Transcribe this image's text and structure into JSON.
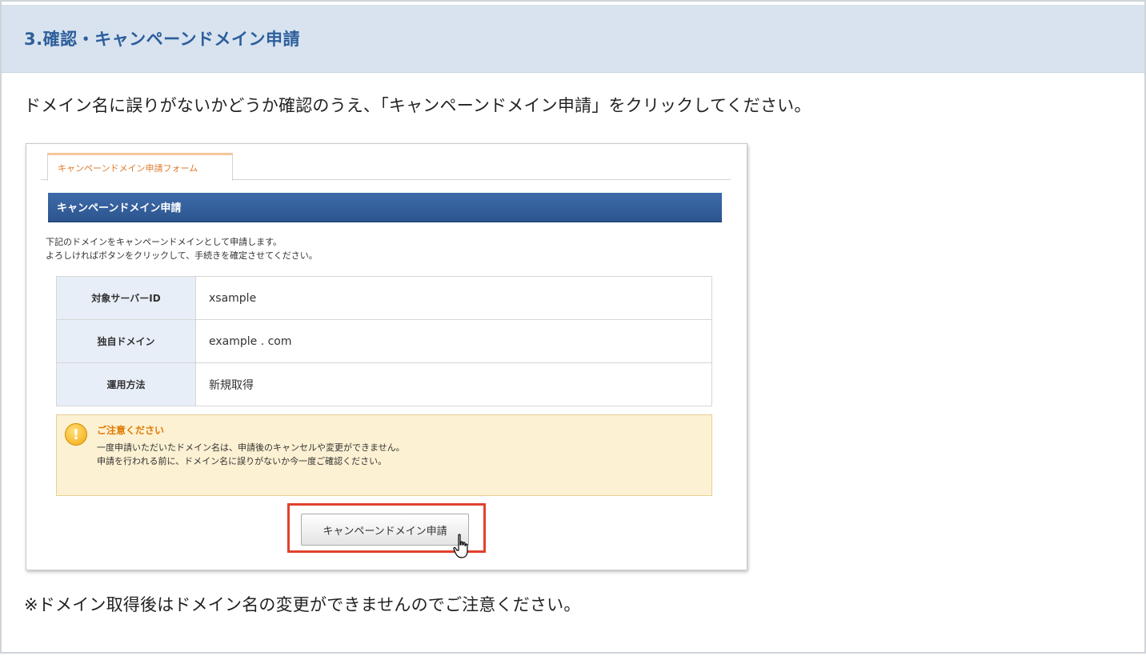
{
  "step": {
    "title": "3.確認・キャンペーンドメイン申請"
  },
  "intro_text": "ドメイン名に誤りがないかどうか確認のうえ、「キャンペーンドメイン申請」をクリックしてください。",
  "screenshot": {
    "tab_label": "キャンペーンドメイン申請フォーム",
    "bar_title": "キャンペーンドメイン申請",
    "description_lines": [
      "下記のドメインをキャンペーンドメインとして申請します。",
      "よろしければボタンをクリックして、手続きを確定させてください。"
    ],
    "rows": [
      {
        "label": "対象サーバーID",
        "value": "xsample"
      },
      {
        "label": "独自ドメイン",
        "value": "example . com"
      },
      {
        "label": "運用方法",
        "value": "新規取得"
      }
    ],
    "warning": {
      "icon": "exclamation-icon",
      "title": "ご注意ください",
      "lines": [
        "一度申請いただいたドメイン名は、申請後のキャンセルや変更ができません。",
        "申請を行われる前に、ドメイン名に誤りがないか今一度ご確認ください。"
      ]
    },
    "apply_button_label": "キャンペーンドメイン申請",
    "highlight_color": "#e2412e"
  },
  "note_text": "※ドメイン取得後はドメイン名の変更ができませんのでご注意ください。",
  "colors": {
    "header_bg": "#d8e3ef",
    "header_text": "#2c5e9b",
    "bar_bg": "#2d5690",
    "warning_bg": "#fdf1d3"
  }
}
